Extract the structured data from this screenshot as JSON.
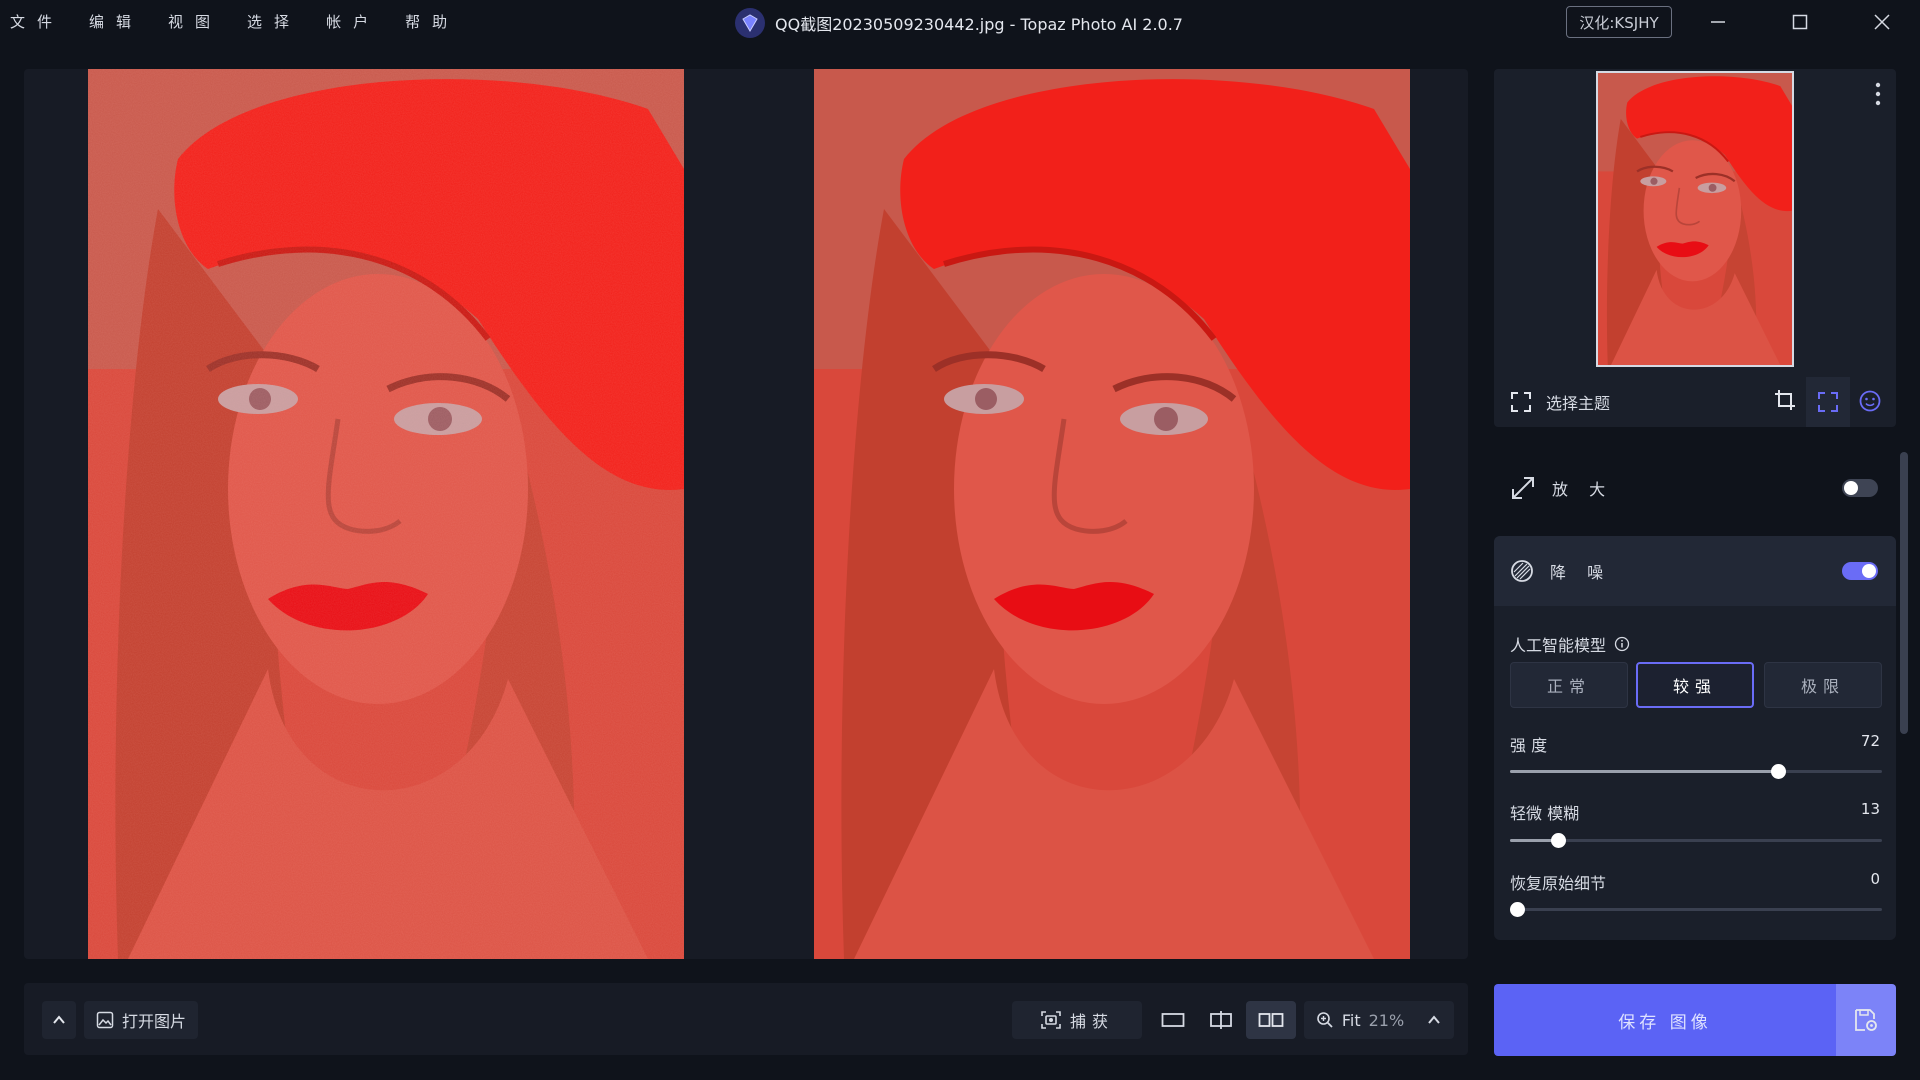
{
  "menu": [
    "文件",
    "编辑",
    "视图",
    "选择",
    "帐户",
    "帮助"
  ],
  "window": {
    "title": "QQ截图20230509230442.jpg - Topaz Photo AI 2.0.7",
    "badge": "汉化:KSJHY"
  },
  "bottombar": {
    "open_label": "打开图片",
    "capture_label": "捕获",
    "zoom_label": "Fit",
    "zoom_value": "21%"
  },
  "panel": {
    "subject_label": "选择主题",
    "upscale": {
      "label": "放 大",
      "enabled": false
    },
    "denoise": {
      "label": "降 噪",
      "enabled": true,
      "model_label": "人工智能模型",
      "models": [
        "正常",
        "较强",
        "极限"
      ],
      "selected_model": "较强",
      "sliders": [
        {
          "label": "强 度",
          "value": "72",
          "fraction": 0.72
        },
        {
          "label": "轻微 模糊",
          "value": "13",
          "fraction": 0.13
        },
        {
          "label": "恢复原始细节",
          "value": "0",
          "fraction": 0.0
        }
      ]
    }
  },
  "save_label": "保存 图像",
  "colors": {
    "accent": "#5b63f5",
    "background": "#0f131b",
    "photo_tint": "#e0463a"
  }
}
